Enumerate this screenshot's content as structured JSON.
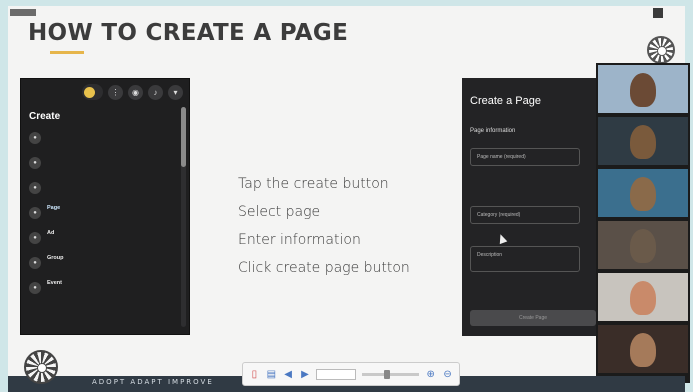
{
  "slide": {
    "tag": "",
    "title": "HOW TO CREATE A PAGE",
    "accent_color": "#e6b54a"
  },
  "phone_left": {
    "user_pill": "",
    "top_icons": [
      "grid-icon",
      "messenger-icon",
      "bell-icon",
      "chevron-down-icon"
    ],
    "create_heading": "Create",
    "items": [
      {
        "icon": "post-icon",
        "title": "",
        "desc": "",
        "highlight": false
      },
      {
        "icon": "story-icon",
        "title": "",
        "desc": "",
        "highlight": false
      },
      {
        "icon": "life-event-icon",
        "title": "",
        "desc": "",
        "highlight": false
      },
      {
        "icon": "page-icon",
        "title": "Page",
        "desc": "",
        "highlight": true
      },
      {
        "icon": "ad-icon",
        "title": "Ad",
        "desc": "",
        "highlight": false
      },
      {
        "icon": "group-icon",
        "title": "Group",
        "desc": "",
        "highlight": false
      },
      {
        "icon": "event-icon",
        "title": "Event",
        "desc": "",
        "highlight": false
      }
    ]
  },
  "steps": [
    "Tap the create button",
    "Select page",
    "Enter information",
    "Click create page button"
  ],
  "phone_right": {
    "breadcrumb": "",
    "title": "Create a Page",
    "section": "Page information",
    "field_name": "Page name (required)",
    "field_category": "Category (required)",
    "field_description": "Description",
    "note_1": "",
    "note_2": "",
    "create_button": "Create Page"
  },
  "video_tiles": [
    {
      "name": "",
      "bg": "#9db4c9",
      "face": "#6b4a35"
    },
    {
      "name": "",
      "bg": "#2f3b44",
      "face": "#7a5a3c"
    },
    {
      "name": "",
      "bg": "#3b6f8e",
      "face": "#8a6a4a"
    },
    {
      "name": "",
      "bg": "#5a5048",
      "face": "#6a5a4a"
    },
    {
      "name": "",
      "bg": "#c8c4be",
      "face": "#c98a6a"
    },
    {
      "name": "",
      "bg": "#3a2d28",
      "face": "#a57a5a"
    }
  ],
  "bottom": {
    "brand_text": "ADOPT  ADAPT  IMPROVE",
    "toolbar": {
      "page_field": "",
      "icons": [
        "save-icon",
        "print-icon",
        "prev-icon",
        "next-icon",
        "zoom-in-icon",
        "zoom-out-icon"
      ]
    }
  }
}
